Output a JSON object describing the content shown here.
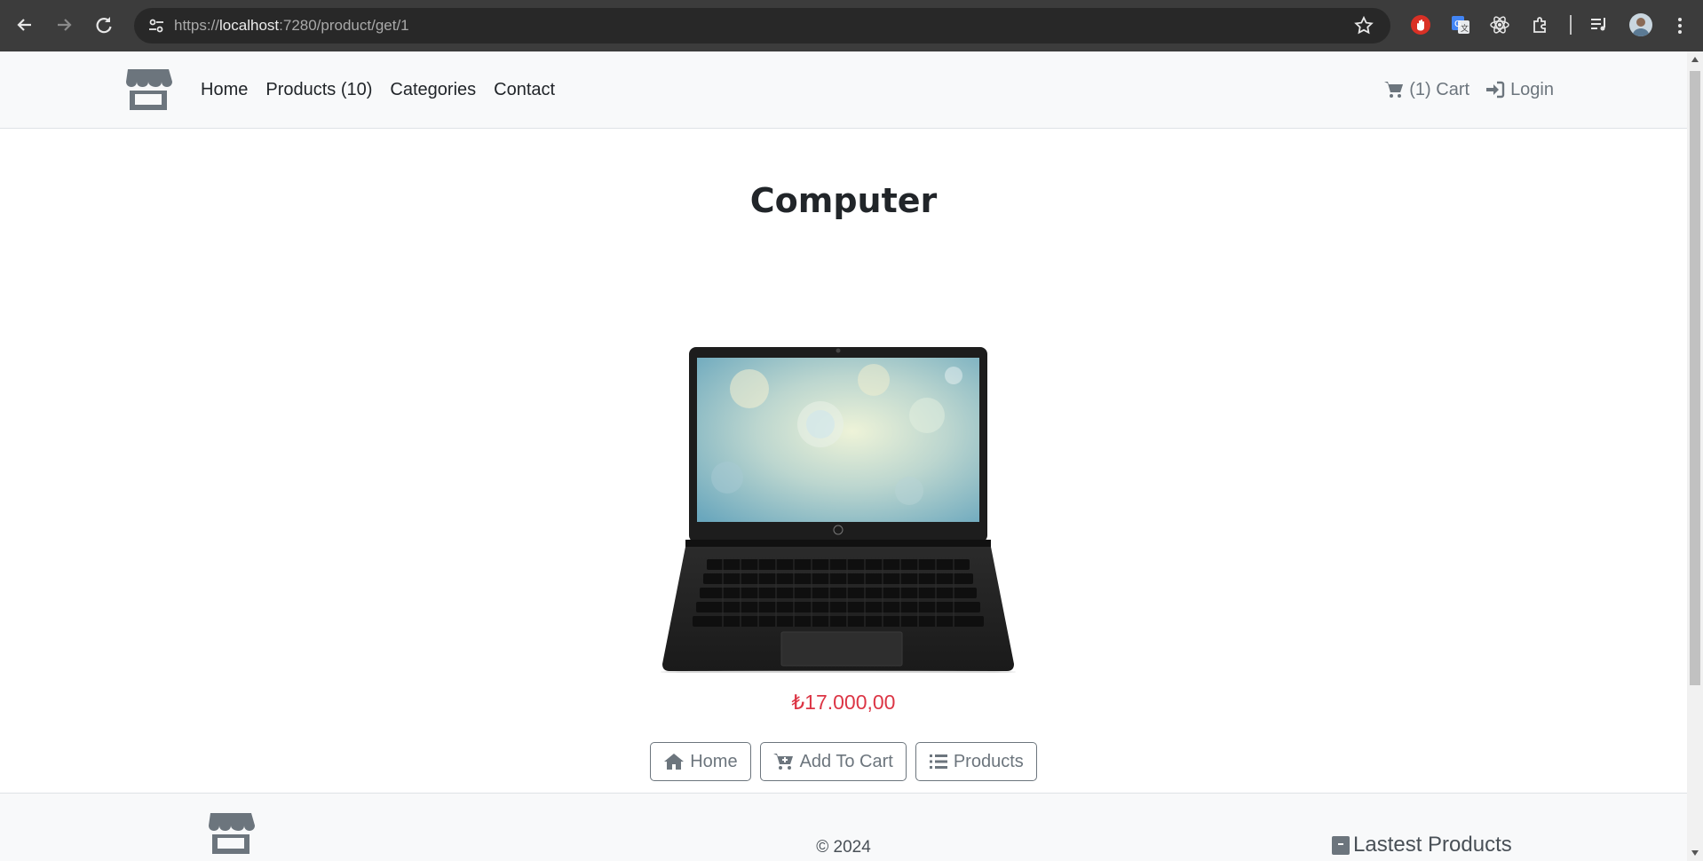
{
  "browser": {
    "url_scheme": "https://",
    "url_host": "localhost",
    "url_rest": ":7280/product/get/1"
  },
  "navbar": {
    "links": [
      {
        "label": "Home"
      },
      {
        "label": "Products (10)"
      },
      {
        "label": "Categories"
      },
      {
        "label": "Contact"
      }
    ],
    "cart_label": "(1) Cart",
    "login_label": "Login"
  },
  "product": {
    "name": "Computer",
    "price": "₺17.000,00",
    "image_icon": "laptop-image"
  },
  "actions": {
    "home_label": "Home",
    "add_to_cart_label": "Add To Cart",
    "products_label": "Products"
  },
  "footer": {
    "copyright": "© 2024",
    "latest_label": "Lastest Products"
  },
  "colors": {
    "accent_price": "#dc3545",
    "secondary": "#6c757d",
    "navbar_bg": "#f8f9fa"
  }
}
